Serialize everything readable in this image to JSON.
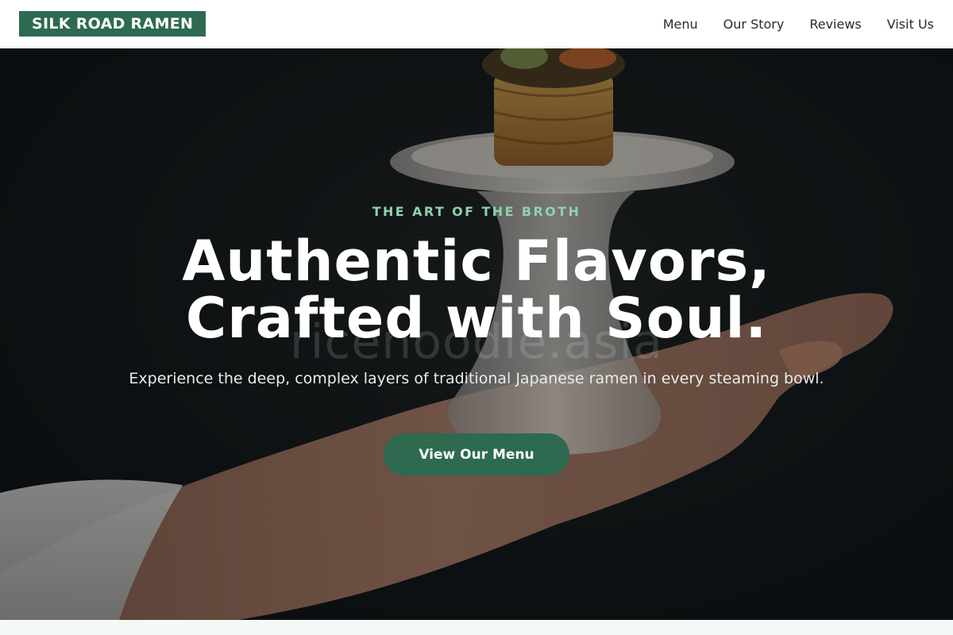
{
  "brand": {
    "name": "SILK ROAD RAMEN"
  },
  "nav": {
    "items": [
      {
        "label": "Menu"
      },
      {
        "label": "Our Story"
      },
      {
        "label": "Reviews"
      },
      {
        "label": "Visit Us"
      }
    ]
  },
  "hero": {
    "eyebrow": "THE ART OF THE BROTH",
    "headline_line1": "Authentic Flavors,",
    "headline_line2": "Crafted with Soul.",
    "subtext": "Experience the deep, complex layers of traditional Japanese ramen in every steaming bowl.",
    "cta_label": "View Our Menu",
    "watermark": "ricenoodle.asia"
  },
  "colors": {
    "brand_green": "#2d6a4f",
    "eyebrow_green": "#8fd1ad",
    "hero_background": "#0f1416"
  }
}
